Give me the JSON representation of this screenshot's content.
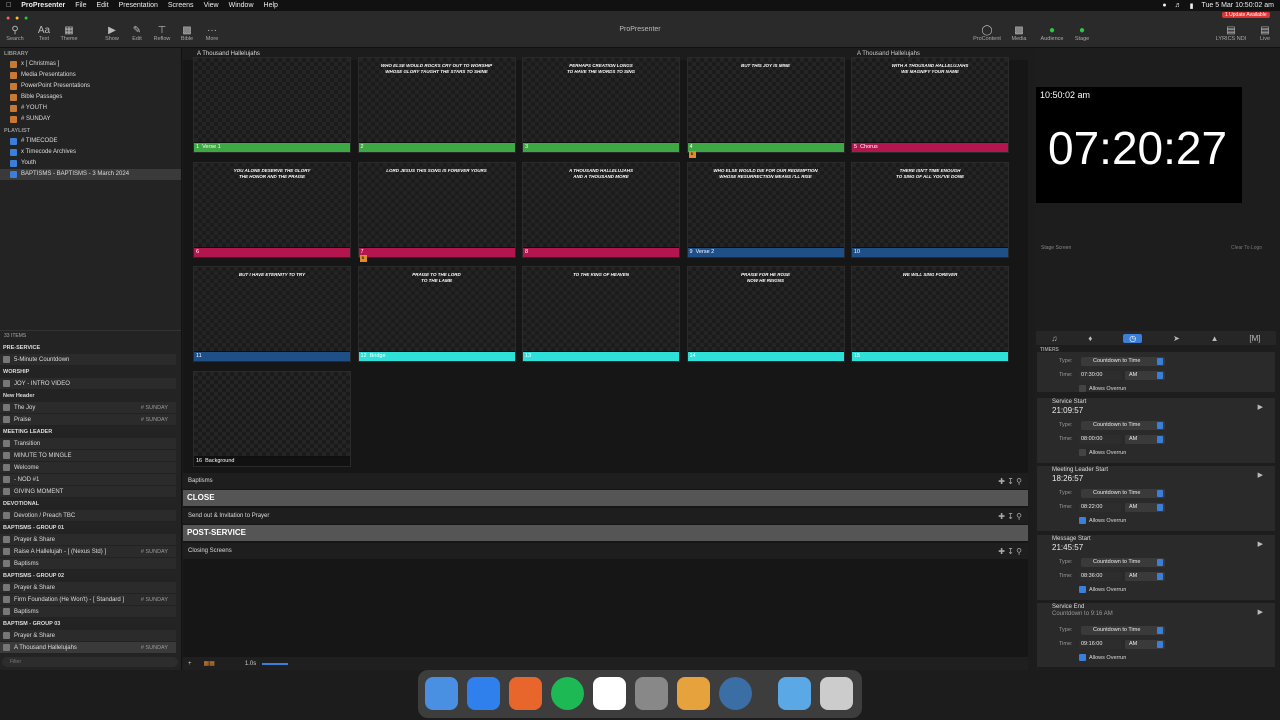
{
  "menubar": {
    "app": "ProPresenter",
    "items": [
      "File",
      "Edit",
      "Presentation",
      "Screens",
      "View",
      "Window",
      "Help"
    ],
    "clock": "Tue 5 Mar  10:50:02 am",
    "update": "1 Update Available"
  },
  "window": {
    "title": "ProPresenter"
  },
  "toolbar": {
    "left": [
      "Search",
      "Text",
      "Theme"
    ],
    "center": [
      "Show",
      "Edit",
      "Reflow",
      "Bible",
      "More"
    ],
    "right": [
      "ProContent",
      "Media",
      "Audience",
      "Stage"
    ],
    "far": [
      "LYRICS NDI",
      "Live"
    ]
  },
  "library": {
    "header": "LIBRARY",
    "items": [
      "x [ Christmas ]",
      "Media Presentations",
      "PowerPoint Presentations",
      "Bible Passages",
      "# YOUTH",
      "# SUNDAY"
    ]
  },
  "playlist": {
    "header": "PLAYLIST",
    "items": [
      "# TIMECODE",
      "x Timecode Archives",
      "Youth",
      "BAPTISMS - BAPTISMS - 3 March 2024"
    ]
  },
  "items_count": "33 ITEMS",
  "filter_placeholder": "Filter",
  "plist": [
    {
      "h": "PRE-SERVICE"
    },
    {
      "t": "5-Minute Countdown"
    },
    {
      "h": "WORSHIP"
    },
    {
      "t": "JOY - INTRO VIDEO"
    },
    {
      "h": "New Header"
    },
    {
      "t": "The Joy",
      "tag": "# SUNDAY"
    },
    {
      "t": "Praise",
      "tag": "# SUNDAY"
    },
    {
      "h": "MEETING LEADER"
    },
    {
      "t": "Transition"
    },
    {
      "t": "MINUTE TO MINGLE"
    },
    {
      "t": "Welcome"
    },
    {
      "t": "- NOD #1"
    },
    {
      "t": "GIVING MOMENT"
    },
    {
      "h": "DEVOTIONAL"
    },
    {
      "t": "Devotion / Preach TBC"
    },
    {
      "h": "BAPTISMS - GROUP 01"
    },
    {
      "t": "Prayer & Share"
    },
    {
      "t": "Raise A Hallelujah - [ (Nexus Std) ]",
      "tag": "# SUNDAY"
    },
    {
      "t": "Baptisms"
    },
    {
      "h": "BAPTISMS - GROUP 02"
    },
    {
      "t": "Prayer & Share"
    },
    {
      "t": "Firm Foundation (He Won't) - [ Standard ]",
      "tag": "# SUNDAY"
    },
    {
      "t": "Baptisms"
    },
    {
      "h": "BAPTISM - GROUP 03"
    },
    {
      "t": "Prayer & Share"
    },
    {
      "t": "A Thousand Hallelujahs",
      "tag": "# SUNDAY",
      "sel": true
    }
  ],
  "presentation": {
    "title": "A Thousand Hallelujahs",
    "right_title": "A Thousand Hallelujahs"
  },
  "slides": [
    {
      "n": "1",
      "name": "Verse 1",
      "text": "",
      "color": "#3ea844"
    },
    {
      "n": "2",
      "name": "",
      "text": "WHO ELSE WOULD ROCKS CRY OUT TO WORSHIP\nWHOSE GLORY TAUGHT THE STARS TO SHINE",
      "color": "#3ea844"
    },
    {
      "n": "3",
      "name": "",
      "text": "PERHAPS CREATION LONGS\nTO HAVE THE WORDS TO SING",
      "color": "#3ea844"
    },
    {
      "n": "4",
      "name": "",
      "text": "BUT THIS JOY IS MINE",
      "color": "#3ea844"
    },
    {
      "n": "5",
      "name": "Chorus",
      "text": "WITH A THOUSAND HALLELUJAHS\nWE MAGNIFY YOUR NAME",
      "color": "#b3164f"
    },
    {
      "n": "6",
      "name": "",
      "text": "YOU ALONE DESERVE THE GLORY\nTHE HONOR AND THE PRAISE",
      "color": "#b3164f"
    },
    {
      "n": "7",
      "name": "",
      "text": "LORD JESUS THIS SONG IS FOREVER YOURS",
      "color": "#b3164f"
    },
    {
      "n": "8",
      "name": "",
      "text": "A THOUSAND HALLELUJAHS\nAND A THOUSAND MORE",
      "color": "#b3164f"
    },
    {
      "n": "9",
      "name": "Verse 2",
      "text": "WHO ELSE WOULD DIE FOR OUR REDEMPTION\nWHOSE RESURRECTION MEANS I'LL RISE",
      "color": "#1e4f86",
      "mark": "B"
    },
    {
      "n": "10",
      "name": "",
      "text": "THERE ISN'T TIME ENOUGH\nTO SING OF ALL YOU'VE DONE",
      "color": "#1e4f86"
    },
    {
      "n": "11",
      "name": "",
      "text": "BUT I HAVE ETERNITY TO TRY",
      "color": "#1e4f86"
    },
    {
      "n": "12",
      "name": "Bridge",
      "text": "PRAISE TO THE LORD\nTO THE LAMB",
      "color": "#2fe0d8",
      "mark": "B"
    },
    {
      "n": "13",
      "name": "",
      "text": "TO THE KING OF HEAVEN",
      "color": "#2fe0d8"
    },
    {
      "n": "14",
      "name": "",
      "text": "PRAISE FOR HE ROSE\nNOW HE REIGNS",
      "color": "#2fe0d8"
    },
    {
      "n": "15",
      "name": "",
      "text": "WE WILL SING FOREVER",
      "color": "#2fe0d8"
    },
    {
      "n": "16",
      "name": "Background",
      "text": "",
      "color": "#111111"
    }
  ],
  "rows": {
    "baptisms": "Baptisms",
    "close": "CLOSE",
    "send_out": "Send out & Invitation to Prayer",
    "post_service": "POST-SERVICE",
    "closing": "Closing Screens"
  },
  "bottom": {
    "speed": "1.0s"
  },
  "preview": {
    "clock": "10:50:02 am",
    "countdown": "07:20:27",
    "stage_screen": "Stage Screen",
    "clear": "Clear To Logo"
  },
  "timers_header": "TIMERS",
  "timers": [
    {
      "name": "",
      "value": "",
      "type": "Countdown to Time",
      "time": "07:30:00",
      "ampm": "AM",
      "overrun": false
    },
    {
      "name": "Service Start",
      "value": "21:09:57",
      "type": "Countdown to Time",
      "time": "08:00:00",
      "ampm": "AM",
      "overrun": false
    },
    {
      "name": "Meeting Leader Start",
      "value": "18:26:57",
      "type": "Countdown to Time",
      "time": "08:22:00",
      "ampm": "AM",
      "overrun": true
    },
    {
      "name": "Message Start",
      "value": "21:45:57",
      "type": "Countdown to Time",
      "time": "08:36:00",
      "ampm": "AM",
      "overrun": true
    },
    {
      "name": "Service End",
      "value": "Countdown to 9:16 AM",
      "type": "Countdown to Time",
      "time": "09:16:00",
      "ampm": "AM",
      "overrun": true
    }
  ],
  "labels": {
    "type": "Type:",
    "time": "Time:",
    "overrun": "Allows Overrun"
  }
}
